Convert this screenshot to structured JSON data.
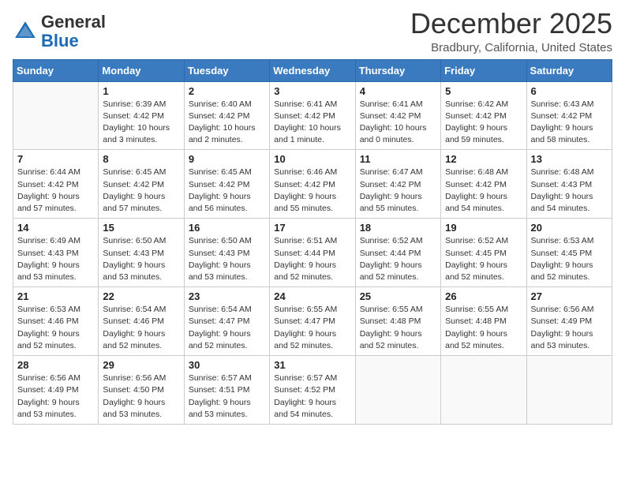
{
  "header": {
    "logo": {
      "general": "General",
      "blue": "Blue",
      "tagline": "GeneralBlue"
    },
    "title": "December 2025",
    "location": "Bradbury, California, United States"
  },
  "weekdays": [
    "Sunday",
    "Monday",
    "Tuesday",
    "Wednesday",
    "Thursday",
    "Friday",
    "Saturday"
  ],
  "weeks": [
    [
      {
        "day": "",
        "info": ""
      },
      {
        "day": "1",
        "info": "Sunrise: 6:39 AM\nSunset: 4:42 PM\nDaylight: 10 hours\nand 3 minutes."
      },
      {
        "day": "2",
        "info": "Sunrise: 6:40 AM\nSunset: 4:42 PM\nDaylight: 10 hours\nand 2 minutes."
      },
      {
        "day": "3",
        "info": "Sunrise: 6:41 AM\nSunset: 4:42 PM\nDaylight: 10 hours\nand 1 minute."
      },
      {
        "day": "4",
        "info": "Sunrise: 6:41 AM\nSunset: 4:42 PM\nDaylight: 10 hours\nand 0 minutes."
      },
      {
        "day": "5",
        "info": "Sunrise: 6:42 AM\nSunset: 4:42 PM\nDaylight: 9 hours\nand 59 minutes."
      },
      {
        "day": "6",
        "info": "Sunrise: 6:43 AM\nSunset: 4:42 PM\nDaylight: 9 hours\nand 58 minutes."
      }
    ],
    [
      {
        "day": "7",
        "info": "Sunrise: 6:44 AM\nSunset: 4:42 PM\nDaylight: 9 hours\nand 57 minutes."
      },
      {
        "day": "8",
        "info": "Sunrise: 6:45 AM\nSunset: 4:42 PM\nDaylight: 9 hours\nand 57 minutes."
      },
      {
        "day": "9",
        "info": "Sunrise: 6:45 AM\nSunset: 4:42 PM\nDaylight: 9 hours\nand 56 minutes."
      },
      {
        "day": "10",
        "info": "Sunrise: 6:46 AM\nSunset: 4:42 PM\nDaylight: 9 hours\nand 55 minutes."
      },
      {
        "day": "11",
        "info": "Sunrise: 6:47 AM\nSunset: 4:42 PM\nDaylight: 9 hours\nand 55 minutes."
      },
      {
        "day": "12",
        "info": "Sunrise: 6:48 AM\nSunset: 4:42 PM\nDaylight: 9 hours\nand 54 minutes."
      },
      {
        "day": "13",
        "info": "Sunrise: 6:48 AM\nSunset: 4:43 PM\nDaylight: 9 hours\nand 54 minutes."
      }
    ],
    [
      {
        "day": "14",
        "info": "Sunrise: 6:49 AM\nSunset: 4:43 PM\nDaylight: 9 hours\nand 53 minutes."
      },
      {
        "day": "15",
        "info": "Sunrise: 6:50 AM\nSunset: 4:43 PM\nDaylight: 9 hours\nand 53 minutes."
      },
      {
        "day": "16",
        "info": "Sunrise: 6:50 AM\nSunset: 4:43 PM\nDaylight: 9 hours\nand 53 minutes."
      },
      {
        "day": "17",
        "info": "Sunrise: 6:51 AM\nSunset: 4:44 PM\nDaylight: 9 hours\nand 52 minutes."
      },
      {
        "day": "18",
        "info": "Sunrise: 6:52 AM\nSunset: 4:44 PM\nDaylight: 9 hours\nand 52 minutes."
      },
      {
        "day": "19",
        "info": "Sunrise: 6:52 AM\nSunset: 4:45 PM\nDaylight: 9 hours\nand 52 minutes."
      },
      {
        "day": "20",
        "info": "Sunrise: 6:53 AM\nSunset: 4:45 PM\nDaylight: 9 hours\nand 52 minutes."
      }
    ],
    [
      {
        "day": "21",
        "info": "Sunrise: 6:53 AM\nSunset: 4:46 PM\nDaylight: 9 hours\nand 52 minutes."
      },
      {
        "day": "22",
        "info": "Sunrise: 6:54 AM\nSunset: 4:46 PM\nDaylight: 9 hours\nand 52 minutes."
      },
      {
        "day": "23",
        "info": "Sunrise: 6:54 AM\nSunset: 4:47 PM\nDaylight: 9 hours\nand 52 minutes."
      },
      {
        "day": "24",
        "info": "Sunrise: 6:55 AM\nSunset: 4:47 PM\nDaylight: 9 hours\nand 52 minutes."
      },
      {
        "day": "25",
        "info": "Sunrise: 6:55 AM\nSunset: 4:48 PM\nDaylight: 9 hours\nand 52 minutes."
      },
      {
        "day": "26",
        "info": "Sunrise: 6:55 AM\nSunset: 4:48 PM\nDaylight: 9 hours\nand 52 minutes."
      },
      {
        "day": "27",
        "info": "Sunrise: 6:56 AM\nSunset: 4:49 PM\nDaylight: 9 hours\nand 53 minutes."
      }
    ],
    [
      {
        "day": "28",
        "info": "Sunrise: 6:56 AM\nSunset: 4:49 PM\nDaylight: 9 hours\nand 53 minutes."
      },
      {
        "day": "29",
        "info": "Sunrise: 6:56 AM\nSunset: 4:50 PM\nDaylight: 9 hours\nand 53 minutes."
      },
      {
        "day": "30",
        "info": "Sunrise: 6:57 AM\nSunset: 4:51 PM\nDaylight: 9 hours\nand 53 minutes."
      },
      {
        "day": "31",
        "info": "Sunrise: 6:57 AM\nSunset: 4:52 PM\nDaylight: 9 hours\nand 54 minutes."
      },
      {
        "day": "",
        "info": ""
      },
      {
        "day": "",
        "info": ""
      },
      {
        "day": "",
        "info": ""
      }
    ]
  ]
}
